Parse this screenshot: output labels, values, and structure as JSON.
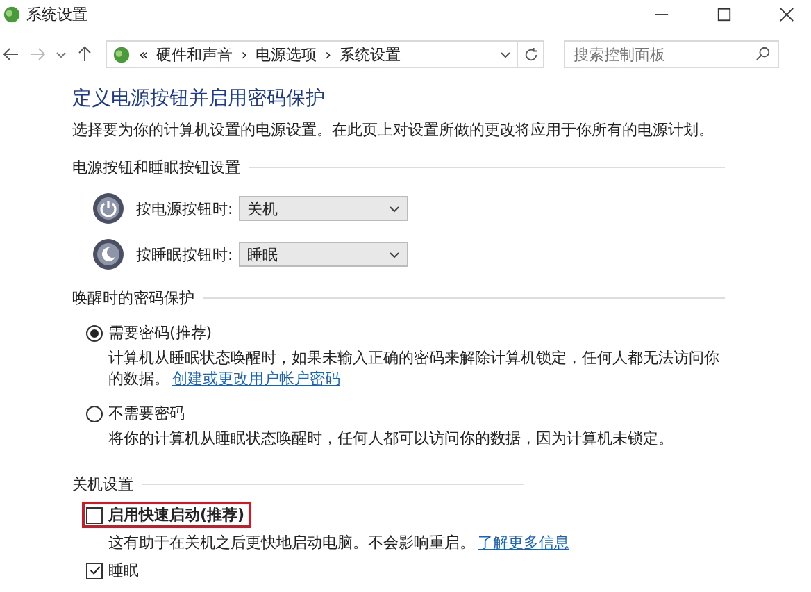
{
  "window": {
    "title": "系统设置"
  },
  "nav": {
    "breadcrumb": [
      "«",
      "硬件和声音",
      "›",
      "电源选项",
      "›",
      "系统设置"
    ],
    "search": {
      "placeholder": "搜索控制面板"
    }
  },
  "heading": "定义电源按钮并启用密码保护",
  "intro": "选择要为你的计算机设置的电源设置。在此页上对设置所做的更改将应用于你所有的电源计划。",
  "button_section": {
    "title": "电源按钮和睡眠按钮设置",
    "rows": [
      {
        "kind": "power",
        "label": "按电源按钮时:",
        "value": "关机"
      },
      {
        "kind": "sleep",
        "label": "按睡眠按钮时:",
        "value": "睡眠"
      }
    ]
  },
  "password_section": {
    "title": "唤醒时的密码保护",
    "options": [
      {
        "label": "需要密码(推荐)",
        "selected": true,
        "description": "计算机从睡眠状态唤醒时，如果未输入正确的密码来解除计算机锁定，任何人都无法访问你的数据。",
        "link": "创建或更改用户帐户密码"
      },
      {
        "label": "不需要密码",
        "selected": false,
        "description": "将你的计算机从睡眠状态唤醒时，任何人都可以访问你的数据，因为计算机未锁定。"
      }
    ]
  },
  "shutdown_section": {
    "title": "关机设置",
    "options": [
      {
        "label": "启用快速启动(推荐)",
        "checked": false,
        "bold": true,
        "highlighted": true,
        "description": "这有助于在关机之后更快地启动电脑。不会影响重启。",
        "link": "了解更多信息"
      },
      {
        "label": "睡眠",
        "checked": true,
        "bold": false,
        "highlighted": false
      }
    ]
  }
}
